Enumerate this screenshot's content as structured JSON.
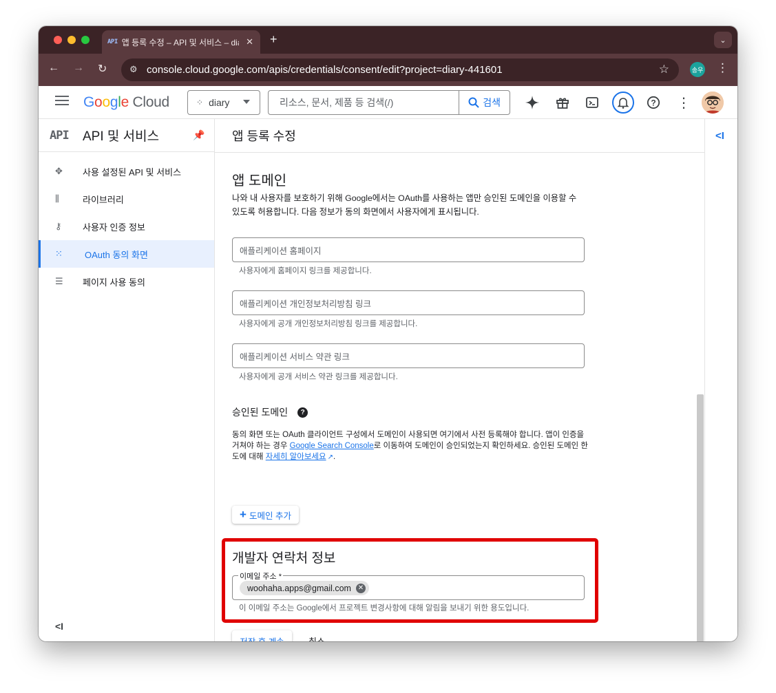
{
  "browser": {
    "tab_favicon": "API",
    "tab_title": "앱 등록 수정 – API 및 서비스 – diary",
    "url": "console.cloud.google.com/apis/credentials/consent/edit?project=diary-441601",
    "profile_badge": "송우",
    "new_tab_symbol": "+",
    "colors": {
      "frame": "#3b2326",
      "toolbar": "#5a3a3e"
    }
  },
  "header": {
    "logo": "Google Cloud",
    "project": "diary",
    "search_placeholder": "리소스, 문서, 제품 등 검색(/)",
    "search_button": "검색",
    "icons": [
      "gemini-icon",
      "gift-icon",
      "cloud-shell-icon",
      "notifications-icon",
      "help-icon",
      "more-vert-icon"
    ],
    "accent": "#1a73e8"
  },
  "sidebar": {
    "logo_text": "API",
    "title": "API 및 서비스",
    "items": [
      {
        "label": "사용 설정된 API 및 서비스",
        "icon": "api-hub-icon",
        "active": false
      },
      {
        "label": "라이브러리",
        "icon": "library-icon",
        "active": false
      },
      {
        "label": "사용자 인증 정보",
        "icon": "key-icon",
        "active": false
      },
      {
        "label": "OAuth 동의 화면",
        "icon": "oauth-dots-icon",
        "active": true
      },
      {
        "label": "페이지 사용 동의",
        "icon": "settings-list-icon",
        "active": false
      }
    ],
    "collapse_symbol": "<I"
  },
  "main": {
    "page_title": "앱 등록 수정",
    "app_domain": {
      "heading": "앱 도메인",
      "desc_line1": "나와 내 사용자를 보호하기 위해 Google에서는 OAuth를 사용하는 앱만 승인된 도메인을 이용할 수",
      "desc_line2": "있도록 허용합니다. 다음 정보가 동의 화면에서 사용자에게 표시됩니다.",
      "fields": [
        {
          "placeholder": "애플리케이션 홈페이지",
          "hint": "사용자에게 홈페이지 링크를 제공합니다."
        },
        {
          "placeholder": "애플리케이션 개인정보처리방침 링크",
          "hint": "사용자에게 공개 개인정보처리방침 링크를 제공합니다."
        },
        {
          "placeholder": "애플리케이션 서비스 약관 링크",
          "hint": "사용자에게 공개 서비스 약관 링크를 제공합니다."
        }
      ]
    },
    "authorized_domains": {
      "heading": "승인된 도메인",
      "line1": "동의 화면 또는 OAuth 클라이언트 구성에서 도메인이 사용되면 여기에서 사전 등록해야 합니다. 앱이 인증을",
      "line2_pre": "거쳐야 하는 경우 ",
      "line2_link": "Google Search Console",
      "line2_post": "로 이동하여 도메인이 승인되었는지 확인하세요. 승인된 도메인 한",
      "line3_pre": "도에 대해 ",
      "line3_link": "자세히 알아보세요",
      "line3_post": ".",
      "add_button": "도메인 추가"
    },
    "developer_contact": {
      "heading": "개발자 연락처 정보",
      "email_label": "이메일 주소 *",
      "email_chip": "woohaha.apps@gmail.com",
      "hint": "이 이메일 주소는 Google에서 프로젝트 변경사항에 대해 알림을 보내기 위한 용도입니다.",
      "highlight_color": "#e00000"
    },
    "save_button": "저장 후 계속",
    "cancel_button": "취소"
  },
  "right_panel": {
    "toggle_symbol": "<I"
  }
}
